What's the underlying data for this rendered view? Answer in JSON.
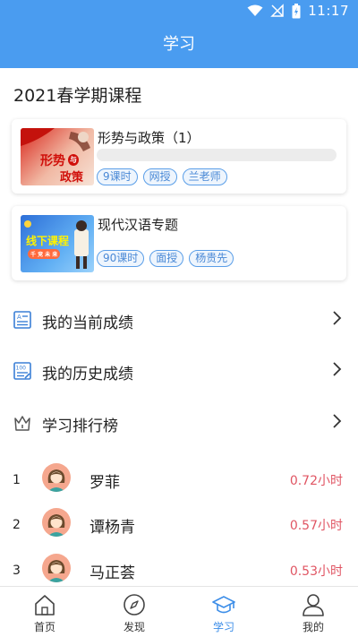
{
  "status_bar": {
    "time": "11:17"
  },
  "header": {
    "title": "学习"
  },
  "semester_title": "2021春学期课程",
  "courses": [
    {
      "title": "形势与政策（1）",
      "has_progress": true,
      "thumb_text": [
        "形势",
        "与",
        "政策"
      ],
      "tags": [
        "9课时",
        "网授",
        "兰老师"
      ]
    },
    {
      "title": "现代汉语专题",
      "has_progress": false,
      "thumb_text": [
        "线下课程",
        "千 竞 未 来"
      ],
      "tags": [
        "90课时",
        "面授",
        "杨贵先"
      ]
    }
  ],
  "menu": [
    {
      "label": "我的当前成绩",
      "icon": "current-grades-icon"
    },
    {
      "label": "我的历史成绩",
      "icon": "history-grades-icon"
    },
    {
      "label": "学习排行榜",
      "icon": "ranking-crown-icon"
    }
  ],
  "ranking": [
    {
      "rank": "1",
      "name": "罗菲",
      "hours": "0.72小时"
    },
    {
      "rank": "2",
      "name": "谭杨青",
      "hours": "0.57小时"
    },
    {
      "rank": "3",
      "name": "马正荟",
      "hours": "0.53小时"
    }
  ],
  "tabs": [
    {
      "label": "首页",
      "icon": "home-icon",
      "active": false
    },
    {
      "label": "发现",
      "icon": "compass-icon",
      "active": false
    },
    {
      "label": "学习",
      "icon": "graduation-cap-icon",
      "active": true
    },
    {
      "label": "我的",
      "icon": "user-icon",
      "active": false
    }
  ],
  "colors": {
    "primary": "#4a9cf0",
    "active_tab": "#3d8ee8",
    "hours": "#e05563",
    "tag": "#4a89d6"
  }
}
